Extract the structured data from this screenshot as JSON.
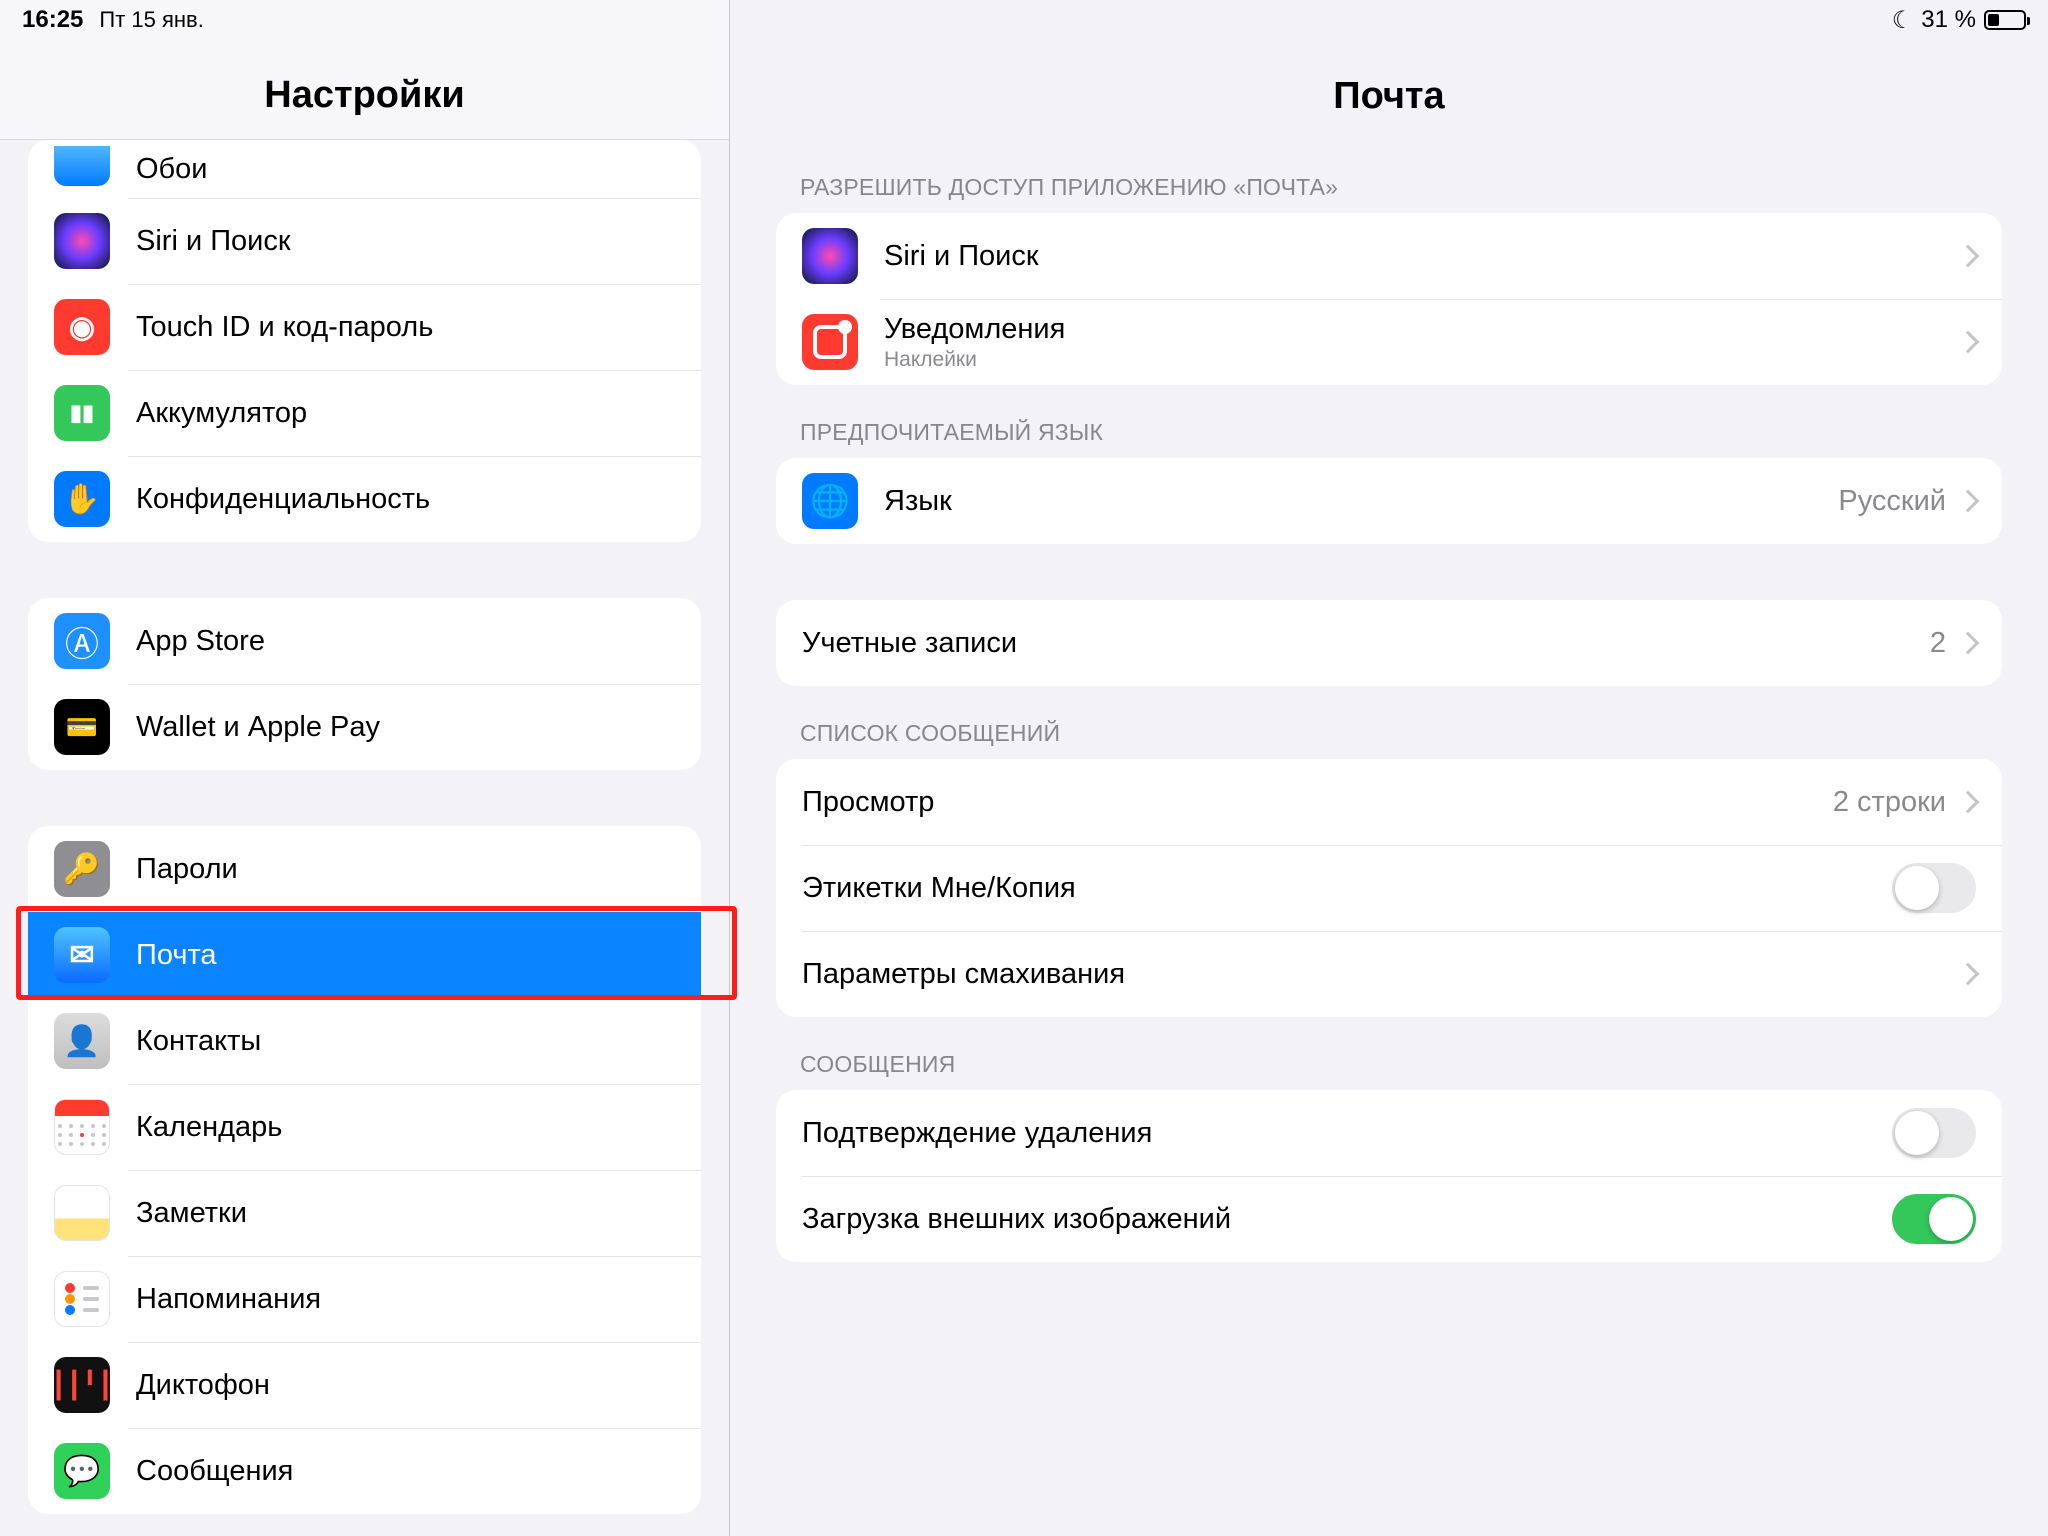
{
  "statusbar": {
    "time": "16:25",
    "date": "Пт 15 янв.",
    "battery_pct": "31 %",
    "dnd_icon": "moon-icon"
  },
  "sidebar": {
    "title": "Настройки",
    "groups": [
      {
        "peek": true,
        "items": [
          {
            "id": "wallpaper",
            "icon": "ic-wall",
            "icon_name": "wallpaper-icon",
            "label": "Обои"
          },
          {
            "id": "siri",
            "icon": "ic-siri",
            "icon_name": "siri-icon",
            "label": "Siri и Поиск"
          },
          {
            "id": "touchid",
            "icon": "ic-touch",
            "icon_name": "fingerprint-icon",
            "label": "Touch ID и код-пароль"
          },
          {
            "id": "battery",
            "icon": "ic-batt",
            "icon_name": "battery-icon",
            "label": "Аккумулятор"
          },
          {
            "id": "privacy",
            "icon": "ic-priv",
            "icon_name": "hand-icon",
            "label": "Конфиденциальность"
          }
        ]
      },
      {
        "items": [
          {
            "id": "appstore",
            "icon": "ic-appst",
            "icon_name": "appstore-icon",
            "label": "App Store"
          },
          {
            "id": "wallet",
            "icon": "ic-wallet",
            "icon_name": "wallet-icon",
            "label": "Wallet и Apple Pay"
          }
        ]
      },
      {
        "items": [
          {
            "id": "passwords",
            "icon": "ic-pass",
            "icon_name": "key-icon",
            "label": "Пароли"
          },
          {
            "id": "mail",
            "icon": "ic-mail",
            "icon_name": "mail-icon",
            "label": "Почта",
            "selected": true,
            "highlighted": true
          },
          {
            "id": "contacts",
            "icon": "ic-contacts",
            "icon_name": "contacts-icon",
            "label": "Контакты"
          },
          {
            "id": "calendar",
            "icon": "ic-cal",
            "icon_name": "calendar-icon",
            "label": "Календарь"
          },
          {
            "id": "notes",
            "icon": "ic-notes",
            "icon_name": "notes-icon",
            "label": "Заметки"
          },
          {
            "id": "reminders",
            "icon": "ic-remind",
            "icon_name": "reminders-icon",
            "label": "Напоминания"
          },
          {
            "id": "voicememo",
            "icon": "ic-voice",
            "icon_name": "voice-memo-icon",
            "label": "Диктофон"
          },
          {
            "id": "messages",
            "icon": "ic-msg",
            "icon_name": "messages-icon",
            "label": "Сообщения"
          }
        ]
      }
    ]
  },
  "detail": {
    "title": "Почта",
    "sections": [
      {
        "header": "РАЗРЕШИТЬ ДОСТУП ПРИЛОЖЕНИЮ «ПОЧТА»",
        "rows": [
          {
            "kind": "nav-icon",
            "icon": "ic-siri",
            "icon_name": "siri-icon",
            "label": "Siri и Поиск"
          },
          {
            "kind": "nav-icon",
            "icon": "ic-notif",
            "icon_name": "notifications-icon",
            "label": "Уведомления",
            "sub": "Наклейки"
          }
        ]
      },
      {
        "header": "ПРЕДПОЧИТАЕМЫЙ ЯЗЫК",
        "rows": [
          {
            "kind": "nav-icon",
            "icon": "ic-lang",
            "icon_name": "globe-icon",
            "label": "Язык",
            "value": "Русский"
          }
        ]
      },
      {
        "rows": [
          {
            "kind": "nav",
            "label": "Учетные записи",
            "value": "2"
          }
        ]
      },
      {
        "header": "СПИСОК СООБЩЕНИЙ",
        "rows": [
          {
            "kind": "nav",
            "label": "Просмотр",
            "value": "2 строки"
          },
          {
            "kind": "toggle",
            "label": "Этикетки Мне/Копия",
            "on": false
          },
          {
            "kind": "nav",
            "label": "Параметры смахивания"
          }
        ]
      },
      {
        "header": "СООБЩЕНИЯ",
        "rows": [
          {
            "kind": "toggle",
            "label": "Подтверждение удаления",
            "on": false
          },
          {
            "kind": "toggle",
            "label": "Загрузка внешних изображений",
            "on": true
          }
        ]
      }
    ]
  }
}
